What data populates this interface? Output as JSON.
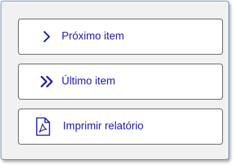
{
  "menu": {
    "next_item_label": "Próximo item",
    "last_item_label": "Último item",
    "print_report_label": "Imprimir relatório"
  },
  "icons": {
    "next": "chevron-right-icon",
    "last": "double-chevron-right-icon",
    "print": "pdf-file-icon"
  },
  "colors": {
    "label_text": "#1a1ab0",
    "panel_border": "#6d8bb8",
    "panel_background": "#f1f1f1"
  }
}
